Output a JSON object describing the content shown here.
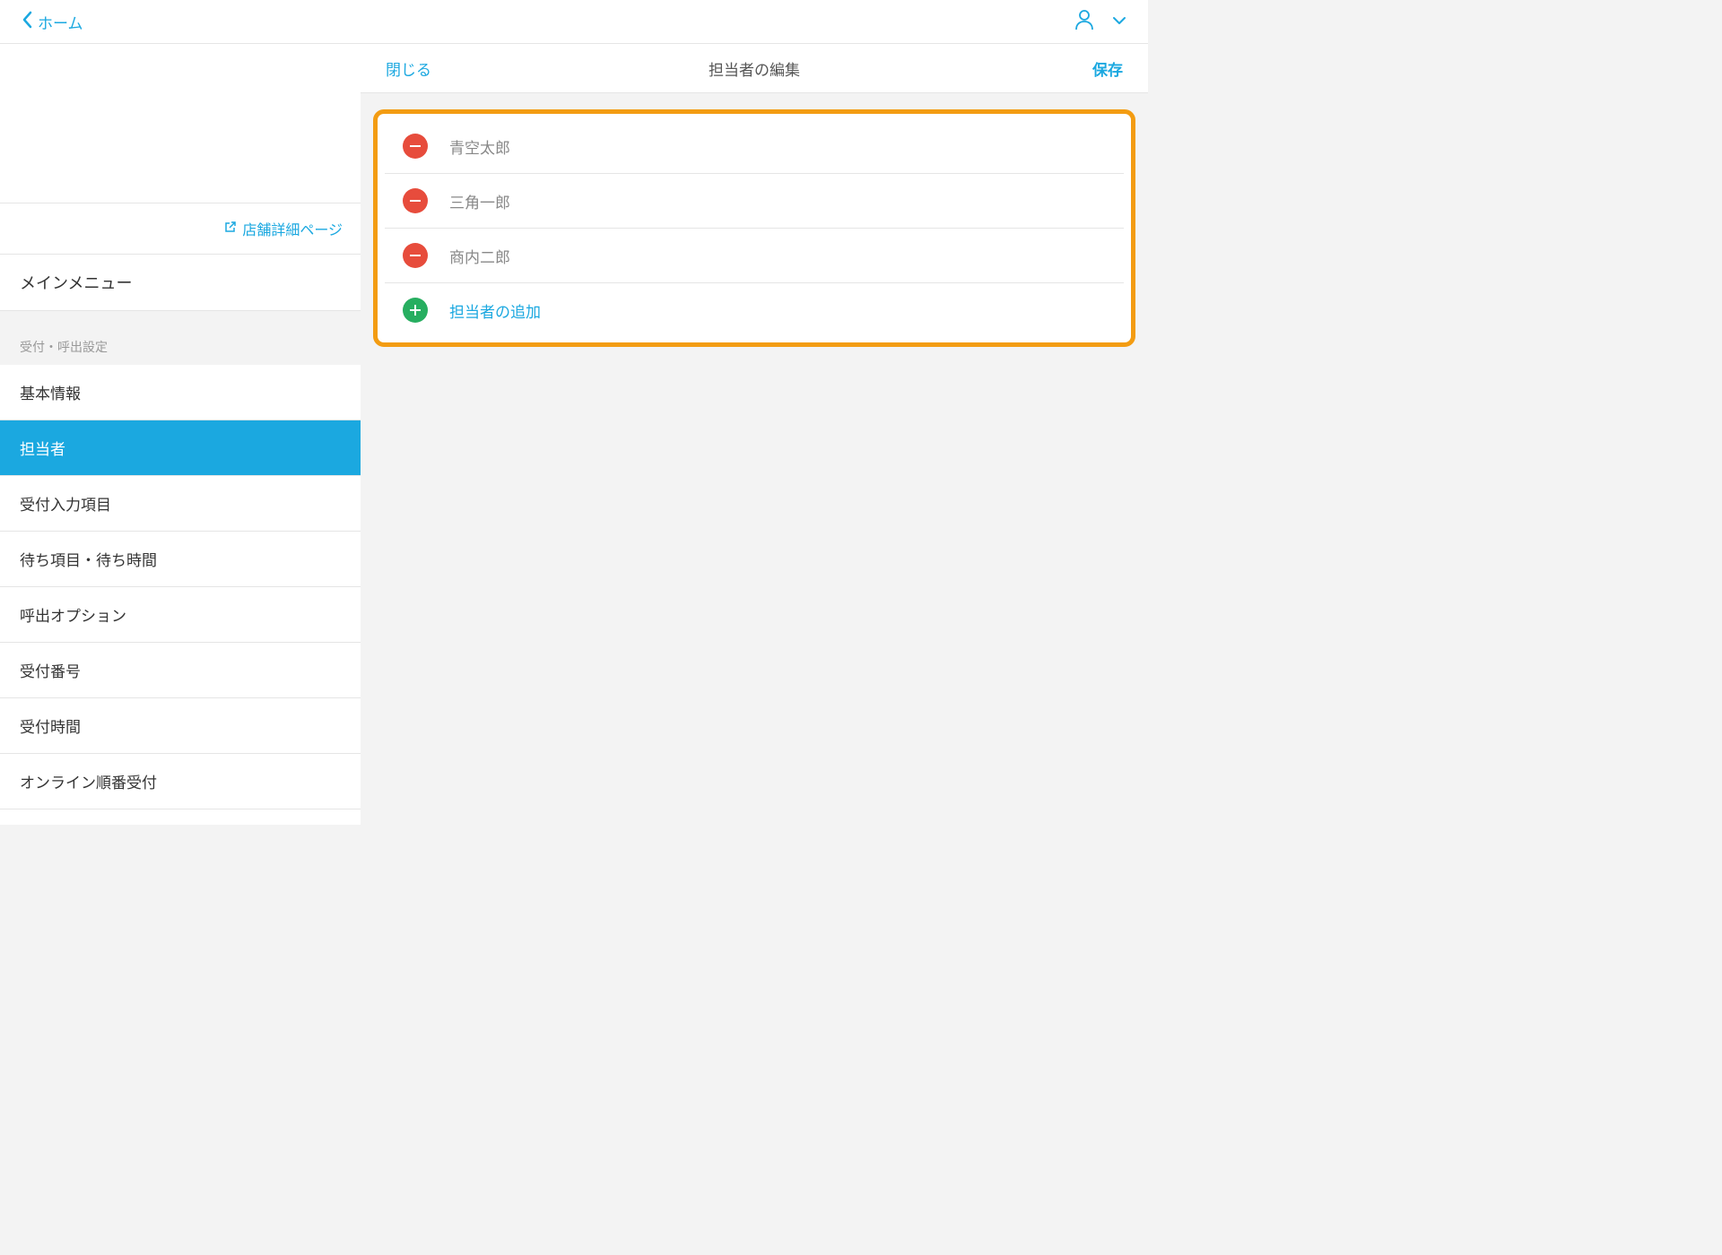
{
  "header": {
    "back_label": "ホーム"
  },
  "sidebar": {
    "store_detail_link": "店舗詳細ページ",
    "main_menu_label": "メインメニュー",
    "section_label": "受付・呼出設定",
    "menu_items": [
      "基本情報",
      "担当者",
      "受付入力項目",
      "待ち項目・待ち時間",
      "呼出オプション",
      "受付番号",
      "受付時間",
      "オンライン順番受付"
    ],
    "active_index": 1
  },
  "content": {
    "close_label": "閉じる",
    "title": "担当者の編集",
    "save_label": "保存",
    "persons": [
      "青空太郎",
      "三角一郎",
      "商内二郎"
    ],
    "add_label": "担当者の追加"
  }
}
